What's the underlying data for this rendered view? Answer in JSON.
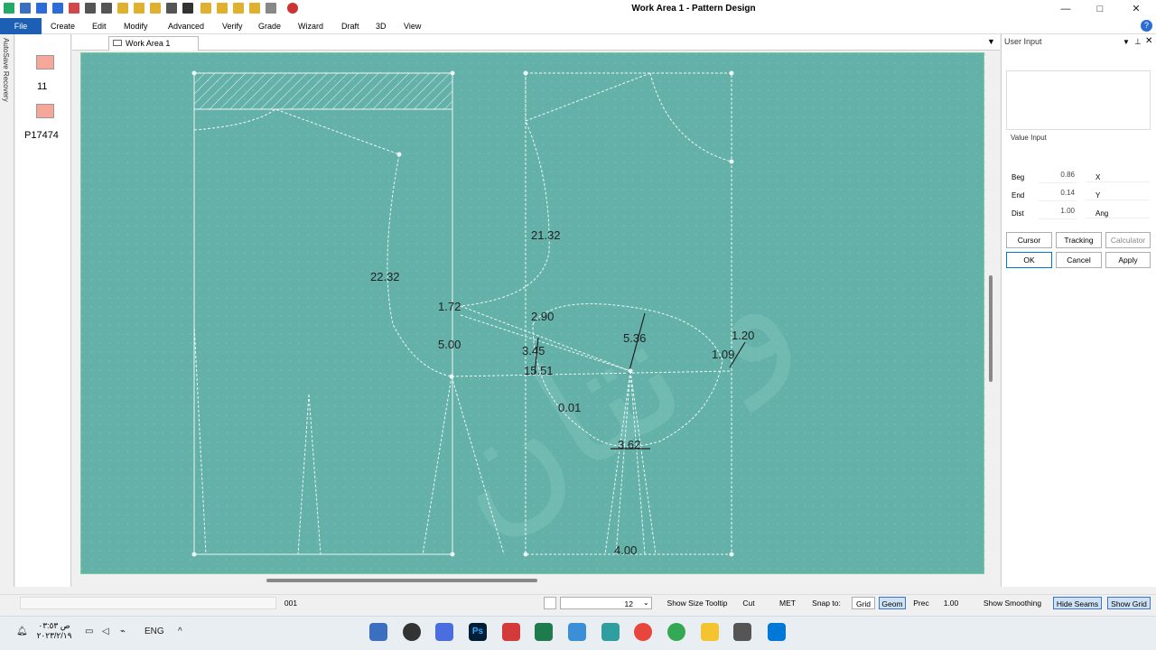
{
  "window": {
    "title": "Work Area 1 - Pattern Design",
    "minimize": "—",
    "maximize": "□",
    "close": "✕"
  },
  "menu": [
    "File",
    "Create",
    "Edit",
    "Modify",
    "Advanced",
    "Verify",
    "Grade",
    "Wizard",
    "Draft",
    "3D",
    "View"
  ],
  "left_tab": {
    "label": "AutoSave Recovery"
  },
  "pieces": [
    {
      "label": "11",
      "color": "#f5a899"
    },
    {
      "label": "P17474",
      "color": "#f5a899"
    }
  ],
  "work_area_tab": {
    "label": "Work Area 1"
  },
  "canvas": {
    "background": "#63b1a9",
    "measurements": [
      "22.32",
      "21.32",
      "1.72",
      "2.90",
      "5.00",
      "3.45",
      "15.51",
      "5.36",
      "1.20",
      "1.09",
      "0.01",
      "3.62",
      "4.00"
    ]
  },
  "user_input": {
    "title": "User Input",
    "value_input_label": "Value Input",
    "rows": [
      {
        "label": "Beg",
        "value": "0.86",
        "unit": "X"
      },
      {
        "label": "End",
        "value": "0.14",
        "unit": "Y"
      },
      {
        "label": "Dist",
        "value": "1.00",
        "unit": "Ang"
      }
    ],
    "mode_buttons": [
      "Cursor",
      "Tracking",
      "Calculator"
    ],
    "action_buttons": [
      "OK",
      "Cancel",
      "Apply"
    ]
  },
  "status": {
    "code": "001",
    "size_value": "12",
    "show_size_tooltip": "Show Size Tooltip",
    "cut": "Cut",
    "met": "MET",
    "snap_to": "Snap to:",
    "grid": "Grid",
    "geom": "Geom",
    "prec": "Prec",
    "prec_value": "1.00",
    "show_smoothing": "Show Smoothing",
    "hide_seams": "Hide Seams",
    "show_grid": "Show Grid"
  },
  "taskbar": {
    "time": "ص ٠٣:٥٣",
    "date": "٢٠٢٣/٢/١٩",
    "lang": "ENG"
  }
}
